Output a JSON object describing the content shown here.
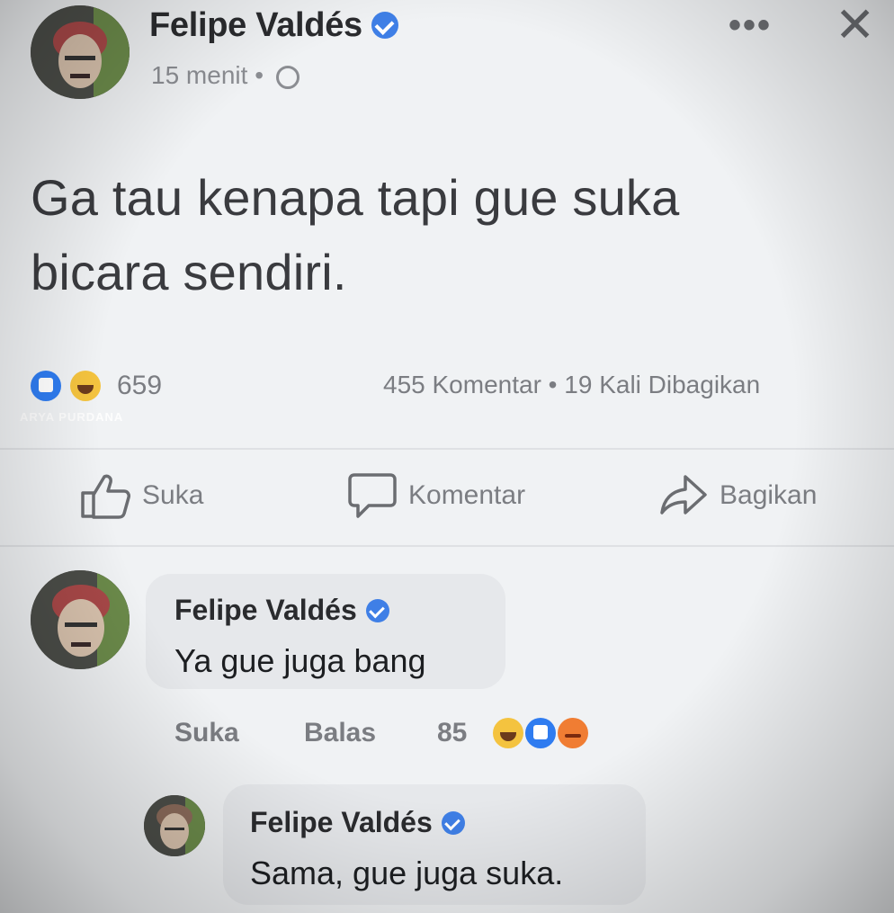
{
  "post": {
    "author": "Felipe Valdés",
    "time": "15 menit",
    "separator": "•",
    "text_line1": "Ga tau kenapa tapi gue suka",
    "text_line2": "bicara sendiri.",
    "reaction_count": "659",
    "comments": "455 Komentar",
    "stats_separator": "•",
    "shares": "19 Kali Dibagikan",
    "watermark": "ARYA PURDANA",
    "more_label": "•••",
    "close_label": "✕"
  },
  "actions": {
    "like": "Suka",
    "comment": "Komentar",
    "share": "Bagikan"
  },
  "comments": [
    {
      "author": "Felipe Valdés",
      "text": "Ya gue juga bang",
      "like": "Suka",
      "reply": "Balas",
      "reaction_count": "85"
    },
    {
      "author": "Felipe Valdés",
      "text": "Sama, gue juga suka."
    }
  ],
  "colors": {
    "verified": "#3f7fe6",
    "like_reaction": "#2f7cf0",
    "haha_reaction": "#f4c33f",
    "angry_reaction": "#f07d33"
  },
  "icons": [
    "verified-badge-icon",
    "globe-icon",
    "more-icon",
    "close-icon",
    "like-icon",
    "comment-icon",
    "share-icon"
  ]
}
